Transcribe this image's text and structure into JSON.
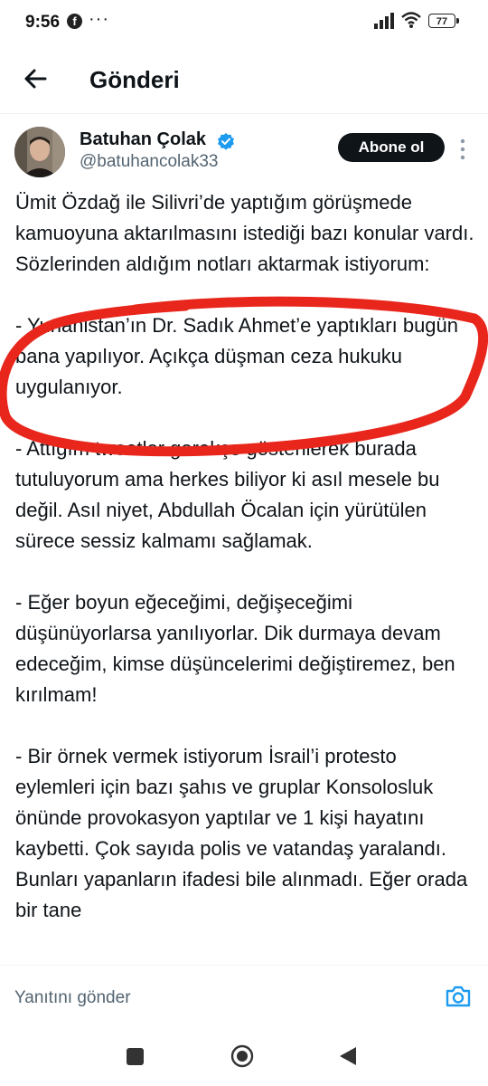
{
  "status_bar": {
    "time": "9:56",
    "fb_glyph": "f",
    "dots": "···",
    "battery": "77"
  },
  "header": {
    "title": "Gönderi",
    "back_icon": "arrow-left-icon"
  },
  "author": {
    "name": "Batuhan Çolak",
    "handle": "@batuhancolak33",
    "verified": true,
    "subscribe_label": "Abone ol"
  },
  "tweet": {
    "paragraphs": [
      "Ümit Özdağ ile Silivri’de yaptığım görüşmede kamuoyuna aktarılmasını istediği bazı konular vardı. Sözlerinden aldığım notları aktarmak istiyorum:",
      "- Yunanistan’ın Dr. Sadık Ahmet’e yaptıkları bugün bana yapılıyor. Açıkça düşman ceza hukuku uygulanıyor.",
      "- Attığım tweetler gerekçe gösterilerek burada tutuluyorum ama herkes biliyor ki asıl mesele bu değil. Asıl niyet, Abdullah Öcalan için yürütülen sürece sessiz kalmamı sağlamak.",
      "- Eğer boyun eğeceğimi, değişeceğimi düşünüyorlarsa yanılıyorlar. Dik durmaya devam edeceğim, kimse düşüncelerimi değiştiremez, ben kırılmam!",
      "- Bir örnek vermek istiyorum İsrail’i protesto eylemleri için bazı şahıs ve gruplar Konsolosluk önünde provokasyon yaptılar ve 1 kişi hayatını kaybetti. Çok sayıda polis ve vatandaş yaralandı. Bunları yapanların ifadesi bile alınmadı. Eğer orada bir tane"
    ],
    "annotation_color": "#e8261c"
  },
  "reply": {
    "placeholder": "Yanıtını gönder"
  },
  "colors": {
    "accent": "#1d9bf0",
    "text": "#0f1419",
    "secondary": "#536471"
  }
}
